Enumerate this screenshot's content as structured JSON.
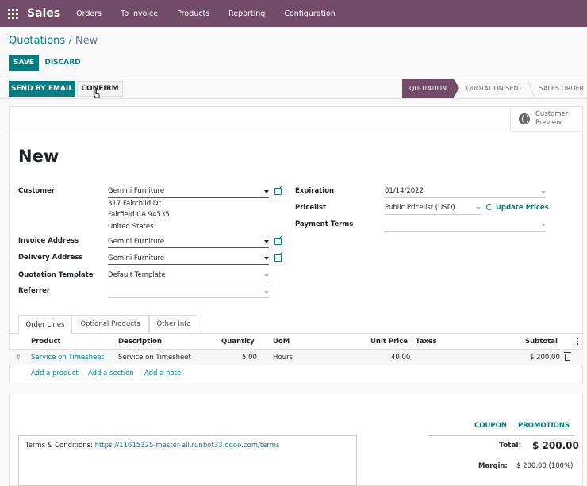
{
  "topbar": {
    "app_name": "Sales",
    "menu": [
      "Orders",
      "To Invoice",
      "Products",
      "Reporting",
      "Configuration"
    ]
  },
  "breadcrumb": {
    "parent": "Quotations",
    "separator": "/",
    "current": "New"
  },
  "actions": {
    "save": "SAVE",
    "discard": "DISCARD",
    "send_by_email": "SEND BY EMAIL",
    "confirm": "CONFIRM"
  },
  "status": {
    "stages": [
      "QUOTATION",
      "QUOTATION SENT",
      "SALES ORDER"
    ],
    "active": "QUOTATION"
  },
  "customer_preview": {
    "line1": "Customer",
    "line2": "Preview"
  },
  "record": {
    "title": "New"
  },
  "left_fields": {
    "customer_label": "Customer",
    "customer_value": "Gemini Furniture",
    "address_line1": "317 Fairchild Dr",
    "address_line2": "Fairfield CA 94535",
    "address_line3": "United States",
    "invoice_label": "Invoice Address",
    "invoice_value": "Gemini Furniture",
    "delivery_label": "Delivery Address",
    "delivery_value": "Gemini Furniture",
    "template_label": "Quotation Template",
    "template_value": "Default Template",
    "referrer_label": "Referrer",
    "referrer_value": ""
  },
  "right_fields": {
    "expiration_label": "Expiration",
    "expiration_value": "01/14/2022",
    "pricelist_label": "Pricelist",
    "pricelist_value": "Public Pricelist (USD)",
    "update_prices": "Update Prices",
    "payment_terms_label": "Payment Terms",
    "payment_terms_value": ""
  },
  "tabs": [
    "Order Lines",
    "Optional Products",
    "Other Info"
  ],
  "table": {
    "headers": [
      "Product",
      "Description",
      "Quantity",
      "UoM",
      "Unit Price",
      "Taxes",
      "Subtotal"
    ],
    "rows": [
      {
        "product": "Service on Timesheet",
        "description": "Service on Timesheet",
        "quantity": "5.00",
        "uom": "Hours",
        "unit_price": "40.00",
        "taxes": "",
        "subtotal": "$ 200.00"
      }
    ],
    "add_product": "Add a product",
    "add_section": "Add a section",
    "add_note": "Add a note"
  },
  "totals": {
    "coupon": "COUPON",
    "promotions": "PROMOTIONS",
    "total_label": "Total:",
    "total_value": "$ 200.00",
    "margin_label": "Margin:",
    "margin_value": "$ 200.00 (100%)"
  },
  "terms": {
    "prefix": "Terms & Conditions: ",
    "link": "https://11615325-master-all.runbot33.odoo.com/terms"
  },
  "colors": {
    "brand": "#714B67",
    "accent": "#017e84"
  }
}
